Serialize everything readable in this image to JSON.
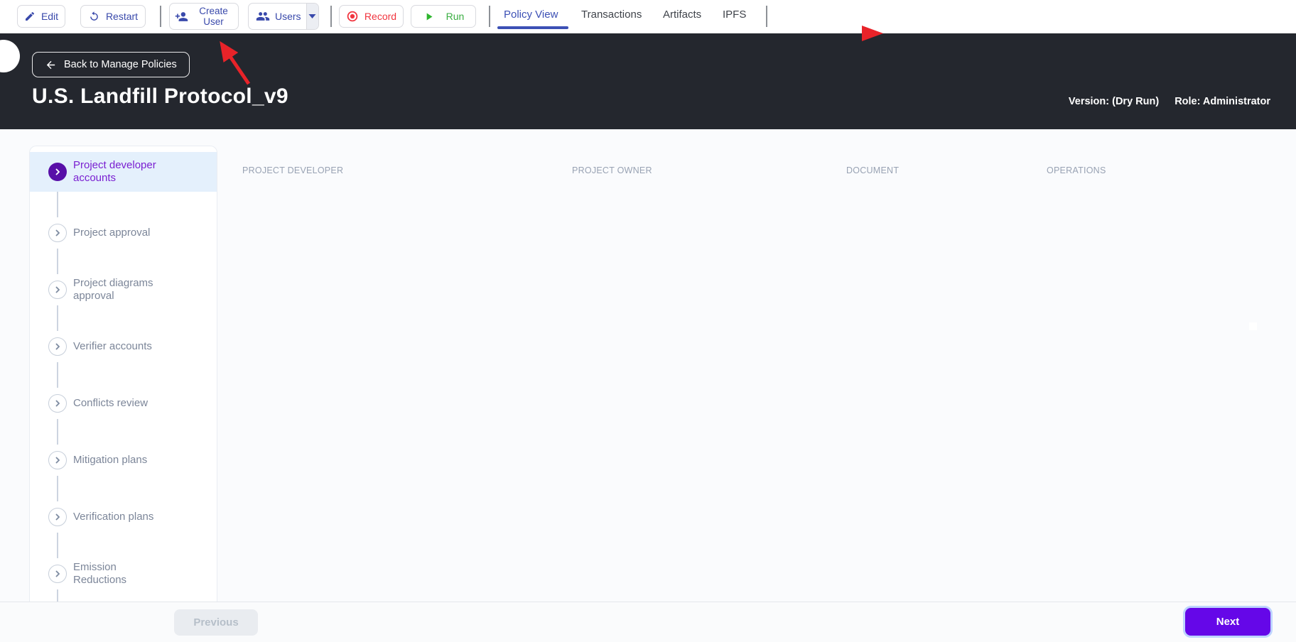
{
  "toolbar": {
    "buttons": {
      "edit": "Edit",
      "restart": "Restart",
      "create_user": "Create User",
      "users": "Users",
      "record": "Record",
      "run": "Run"
    },
    "tabs": [
      {
        "label": "Policy View",
        "active": true
      },
      {
        "label": "Transactions",
        "active": false
      },
      {
        "label": "Artifacts",
        "active": false
      },
      {
        "label": "IPFS",
        "active": false
      }
    ]
  },
  "header": {
    "back_label": "Back to Manage Policies",
    "title": "U.S. Landfill Protocol_v9",
    "version_label": "Version: (Dry Run)",
    "role_label": "Role: Administrator"
  },
  "sidebar": {
    "items": [
      {
        "label": "Project developer accounts",
        "active": true
      },
      {
        "label": "Project approval",
        "active": false
      },
      {
        "label": "Project diagrams approval",
        "active": false
      },
      {
        "label": "Verifier accounts",
        "active": false
      },
      {
        "label": "Conflicts review",
        "active": false
      },
      {
        "label": "Mitigation plans",
        "active": false
      },
      {
        "label": "Verification plans",
        "active": false
      },
      {
        "label": "Emission Reductions",
        "active": false
      }
    ]
  },
  "table": {
    "columns": [
      "PROJECT DEVELOPER",
      "PROJECT OWNER",
      "DOCUMENT",
      "OPERATIONS"
    ]
  },
  "footer": {
    "previous_label": "Previous",
    "next_label": "Next"
  },
  "colors": {
    "primary_blue": "#3949ab",
    "tab_active_blue": "#3c50b5",
    "record_red": "#f1353f",
    "run_green": "#2db52d",
    "active_step_circle_purple": "#580fa8",
    "active_step_text_purple": "#7a1fd1",
    "active_step_bg": "#e4f0fc",
    "next_button_purple": "#6507e8",
    "dark_header_bg": "#24272e",
    "annotation_red": "#e82329"
  },
  "icons": {
    "edit": "pencil-icon",
    "restart": "restart-icon",
    "create_user": "person-add-icon",
    "users": "people-icon",
    "users_menu": "chevron-down-icon",
    "record": "record-icon",
    "run": "play-icon",
    "back": "arrow-left-icon",
    "step": "chevron-right-icon"
  }
}
